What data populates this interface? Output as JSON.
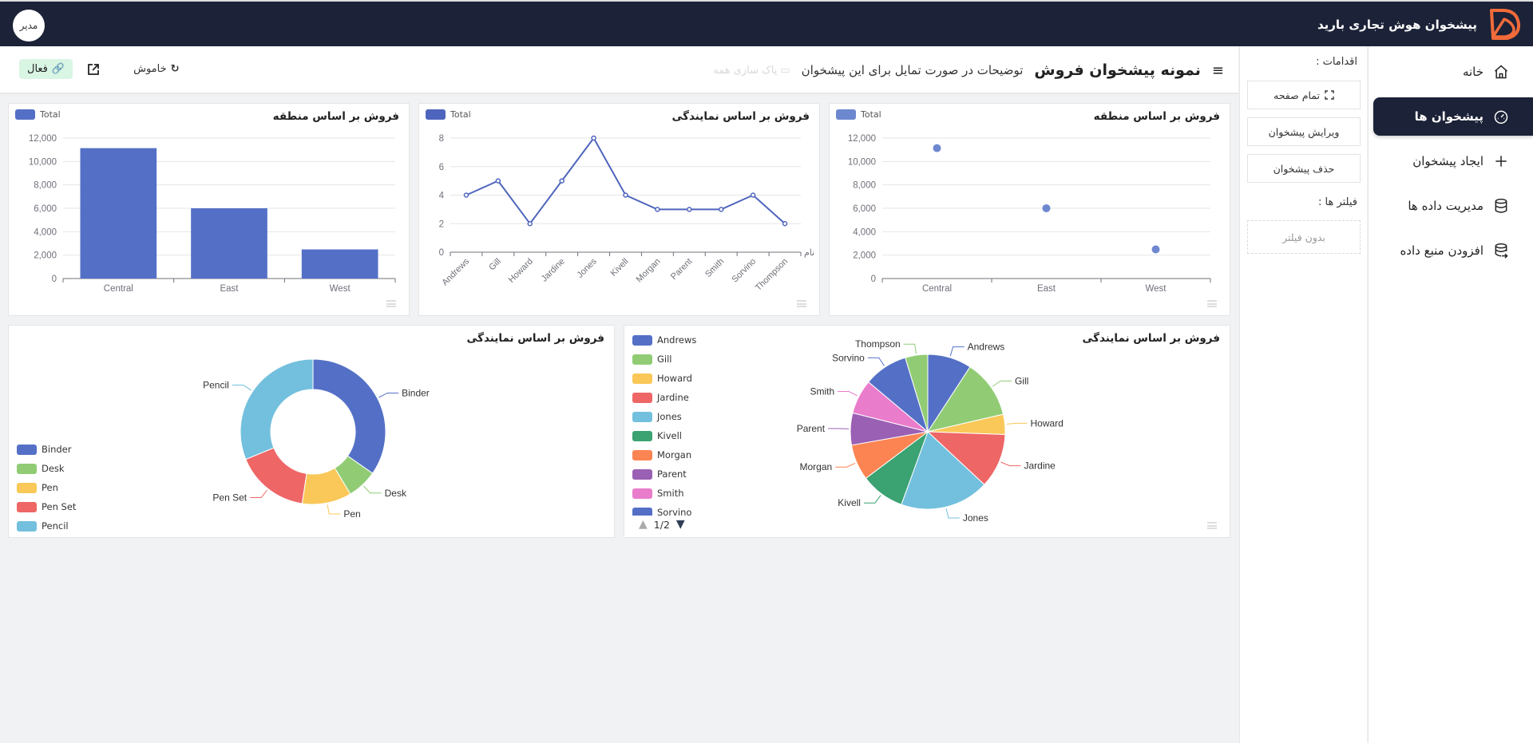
{
  "topbar": {
    "brand_title": "پیشخوان هوش تجاری بارید",
    "avatar_label": "مدیر"
  },
  "sidebar": {
    "items": [
      {
        "label": "خانه",
        "icon": "home-icon",
        "active": false
      },
      {
        "label": "پیشخوان ها",
        "icon": "dashboard-gauge-icon",
        "active": true
      },
      {
        "label": "ایجاد پیشخوان",
        "icon": "plus-icon",
        "active": false
      },
      {
        "label": "مدیریت داده ها",
        "icon": "database-icon",
        "active": false
      },
      {
        "label": "افزودن منبع داده",
        "icon": "database-add-icon",
        "active": false
      }
    ]
  },
  "actions": {
    "actions_label": "اقدامات :",
    "fullscreen_label": "تمام صفحه",
    "edit_label": "ویرایش پیشخوان",
    "delete_label": "حذف پیشخوان",
    "filters_label": "فیلتر ها :",
    "no_filter_label": "بدون فیلتر"
  },
  "header": {
    "title": "نمونه پیشخوان فروش",
    "description": "توضیحات در صورت تمایل برای این پیشخوان",
    "clear_all_label": "پاک سازی همه",
    "refresh_label": "خاموش",
    "active_label": "فعال"
  },
  "colors": {
    "primary": "#5470c6",
    "dark": "#1c2237",
    "accent": "#f26b3a",
    "active_bg": "#d9f5e3"
  },
  "chart_data": [
    {
      "id": "scatter-region",
      "type": "scatter",
      "title": "فروش بر اساس منطقه",
      "legend": "Total",
      "categories": [
        "Central",
        "East",
        "West"
      ],
      "values": [
        11139,
        6002,
        2487
      ],
      "yticks": [
        "0",
        "2,000",
        "4,000",
        "6,000",
        "8,000",
        "10,000",
        "12,000"
      ],
      "ylim": [
        0,
        12000
      ],
      "color": "#6e88d0"
    },
    {
      "id": "line-rep",
      "type": "line",
      "title": "فروش بر اساس نمایندگی",
      "legend": "Total",
      "xlabel": "نام",
      "categories": [
        "Andrews",
        "Gill",
        "Howard",
        "Jardine",
        "Jones",
        "Kivell",
        "Morgan",
        "Parent",
        "Smith",
        "Sorvino",
        "Thompson"
      ],
      "values": [
        4,
        5,
        2,
        5,
        8,
        4,
        3,
        3,
        3,
        4,
        2
      ],
      "yticks": [
        "0",
        "2",
        "4",
        "6",
        "8"
      ],
      "ylim": [
        0,
        8
      ],
      "color": "#4f65bd"
    },
    {
      "id": "bar-region",
      "type": "bar",
      "title": "فروش بر اساس منطقه",
      "legend": "Total",
      "categories": [
        "Central",
        "East",
        "West"
      ],
      "values": [
        11139,
        6002,
        2487
      ],
      "yticks": [
        "0",
        "2,000",
        "4,000",
        "6,000",
        "8,000",
        "10,000",
        "12,000"
      ],
      "ylim": [
        0,
        12000
      ],
      "color": "#5470c6"
    },
    {
      "id": "pie-rep",
      "type": "pie",
      "title": "فروش بر اساس نمایندگی",
      "labels": [
        "Andrews",
        "Gill",
        "Howard",
        "Jardine",
        "Jones",
        "Kivell",
        "Morgan",
        "Parent",
        "Smith",
        "Sorvino",
        "Thompson"
      ],
      "values": [
        9.2,
        12.2,
        4.2,
        11.4,
        18.6,
        9.2,
        7.5,
        6.7,
        7.2,
        9.2,
        4.7
      ],
      "colors": [
        "#5470c6",
        "#91cc75",
        "#fac858",
        "#ee6666",
        "#73c0de",
        "#3ba272",
        "#fc8452",
        "#9a60b4",
        "#ea7ccc",
        "#5470c6",
        "#91cc75"
      ],
      "legend_page": "1/2"
    },
    {
      "id": "donut-item",
      "type": "pie",
      "title": "فروش بر اساس نمایندگی",
      "labels": [
        "Binder",
        "Desk",
        "Pen",
        "Pen Set",
        "Pencil"
      ],
      "values": [
        34.7,
        6.7,
        11.0,
        16.4,
        31.2
      ],
      "colors": [
        "#5470c6",
        "#91cc75",
        "#fac858",
        "#ee6666",
        "#73c0de"
      ]
    }
  ]
}
